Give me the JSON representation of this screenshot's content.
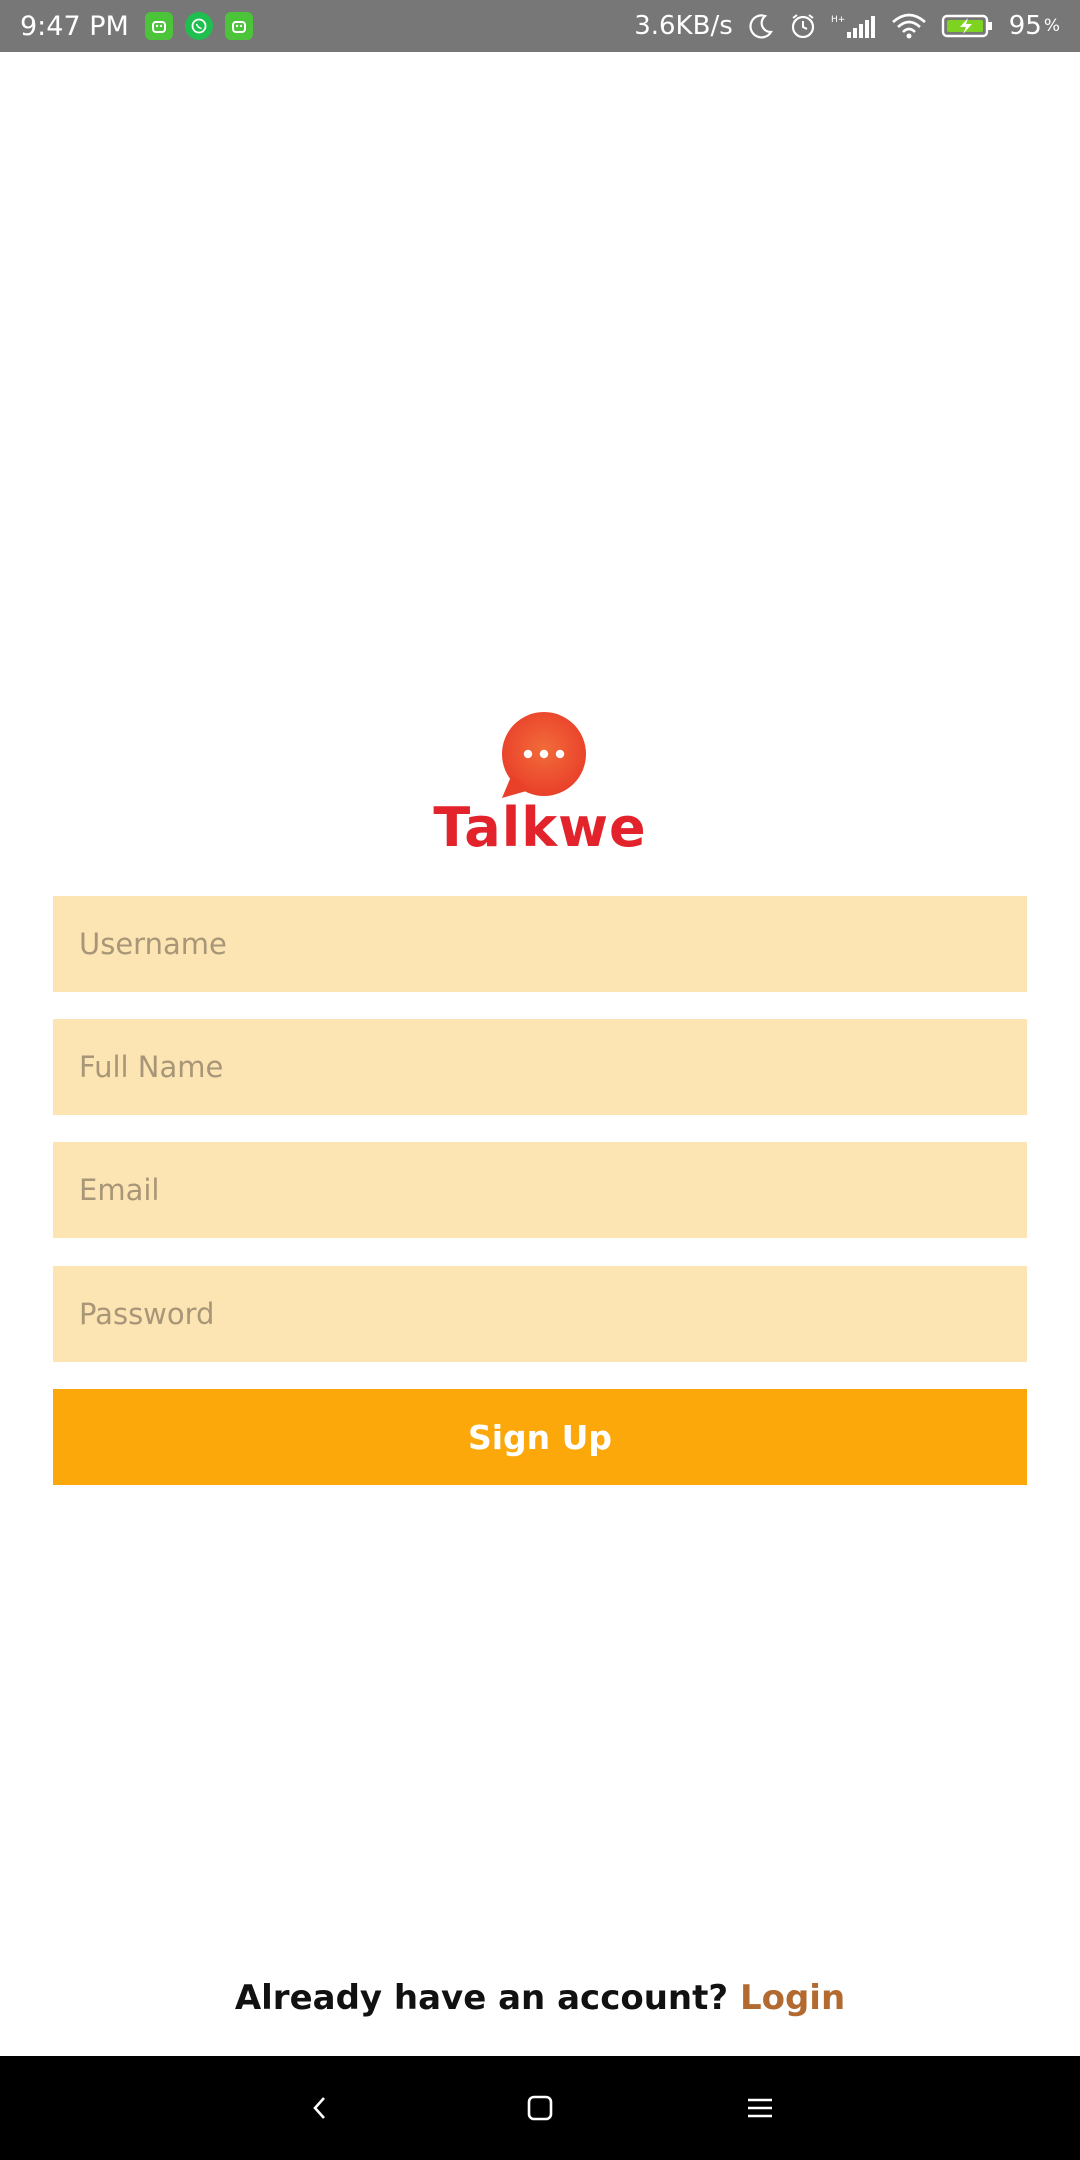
{
  "status_bar": {
    "time": "9:47 PM",
    "net_speed": "3.6KB/s",
    "battery_value": "95",
    "battery_unit": "%",
    "icons": [
      "android-notif-icon",
      "whatsapp-icon",
      "android-notif-icon",
      "moon-icon",
      "alarm-icon",
      "signal-icon",
      "wifi-icon",
      "battery-charging-icon"
    ]
  },
  "logo": {
    "title": "Talkwe",
    "color": "#e2232b",
    "bubble_color": "#ef5a30"
  },
  "form": {
    "username_placeholder": "Username",
    "fullname_placeholder": "Full Name",
    "email_placeholder": "Email",
    "password_placeholder": "Password",
    "field_color": "#fde4b3",
    "signup_label": "Sign Up",
    "signup_color": "#fca80a"
  },
  "footer": {
    "prompt": "Already have an account?",
    "login_label": "Login"
  },
  "nav_bar": {
    "icons": [
      "back-icon",
      "home-icon",
      "menu-icon"
    ]
  }
}
